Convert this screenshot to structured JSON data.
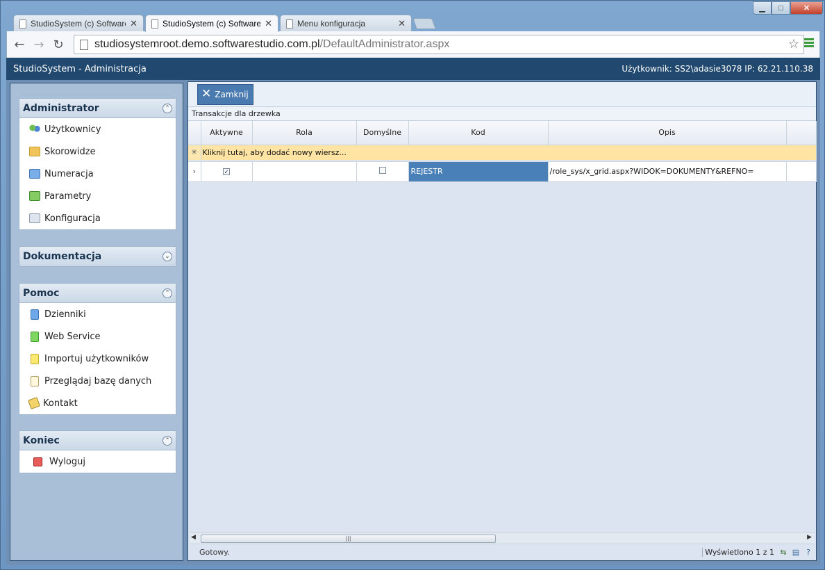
{
  "browser": {
    "tabs": [
      {
        "label": "StudioSystem (c) Software",
        "active": false
      },
      {
        "label": "StudioSystem (c) Software",
        "active": true
      },
      {
        "label": "Menu konfiguracja",
        "active": false
      }
    ],
    "url_host": "studiosystemroot.demo.softwarestudio.com.pl",
    "url_path": "/DefaultAdministrator.aspx",
    "window_controls": {
      "minimize": "▁",
      "maximize": "□",
      "close": "✕"
    }
  },
  "app": {
    "title": "StudioSystem - Administracja",
    "user_info": "Użytkownik: SS2\\adasie3078 IP: 62.21.110.38"
  },
  "sidebar": {
    "administrator": {
      "title": "Administrator",
      "items": [
        {
          "label": "Użytkownicy",
          "icon": "users-icon"
        },
        {
          "label": "Skorowidze",
          "icon": "folder-icon"
        },
        {
          "label": "Numeracja",
          "icon": "folder-icon"
        },
        {
          "label": "Parametry",
          "icon": "folder-icon"
        },
        {
          "label": "Konfiguracja",
          "icon": "folder-icon"
        }
      ]
    },
    "dokumentacja": {
      "title": "Dokumentacja"
    },
    "pomoc": {
      "title": "Pomoc",
      "items": [
        {
          "label": "Dzienniki",
          "icon": "document-icon"
        },
        {
          "label": "Web Service",
          "icon": "document-icon"
        },
        {
          "label": "Importuj użytkowników",
          "icon": "document-icon"
        },
        {
          "label": "Przeglądaj bazę danych",
          "icon": "document-icon"
        },
        {
          "label": "Kontakt",
          "icon": "contact-icon"
        }
      ]
    },
    "koniec": {
      "title": "Koniec",
      "items": [
        {
          "label": "Wyloguj",
          "icon": "logout-icon"
        }
      ]
    }
  },
  "content": {
    "close_button": "Zamknij",
    "grid_caption": "Transakcje dla drzewka",
    "columns": [
      "Aktywne",
      "Rola",
      "Domyślne",
      "Kod",
      "Opis"
    ],
    "add_row_text": "Kliknij tutaj, aby dodać nowy wiersz...",
    "rows": [
      {
        "aktywne": true,
        "rola": "",
        "domyslne": false,
        "kod": "REJESTR",
        "opis": "/role_sys/x_grid.aspx?WIDOK=DOKUMENTY&REFNO="
      }
    ],
    "status": "Gotowy.",
    "record_count": "Wyświetlono 1 z 1"
  }
}
